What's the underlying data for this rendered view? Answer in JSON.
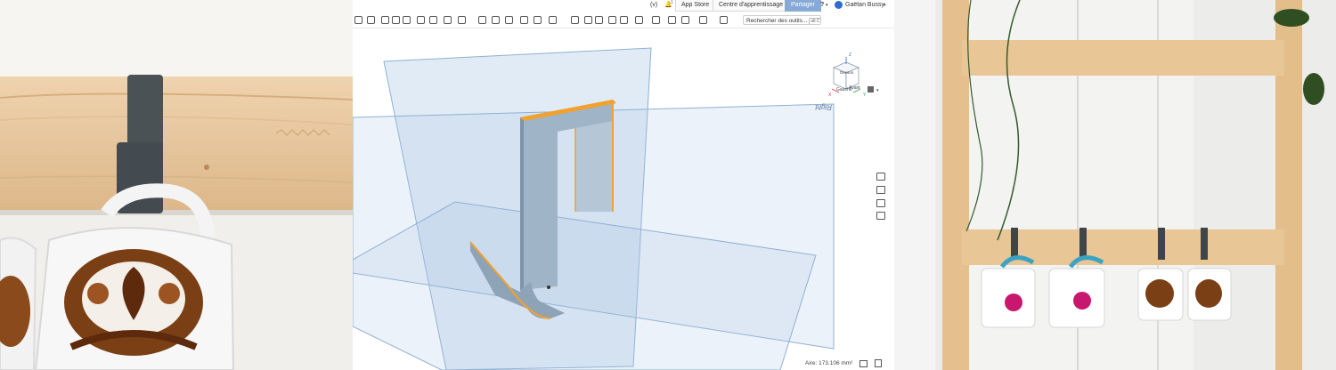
{
  "topbar": {
    "version_label": "(v)",
    "notification_count": "1",
    "app_store": "App Store",
    "learning_center": "Centre d'apprentissage",
    "share": "Partager",
    "help": "?",
    "user_name": "Gaëtan Bussy"
  },
  "toolbar": {
    "search_placeholder": "Rechercher des outils...",
    "search_shortcut": "alt C"
  },
  "viewcube": {
    "front": "Gauche",
    "right": "Avant",
    "top": "Dessus",
    "axis_z": "Z",
    "axis_x": "X",
    "axis_y": "Y"
  },
  "viewport": {
    "plane_label": "Right"
  },
  "status": {
    "area": "Aire: 173.106 mm²"
  },
  "colors": {
    "plane": "#a9c6e3",
    "part": "#8fa3b6",
    "edge_highlight": "#f2a12a",
    "accent": "#86a9d6"
  }
}
